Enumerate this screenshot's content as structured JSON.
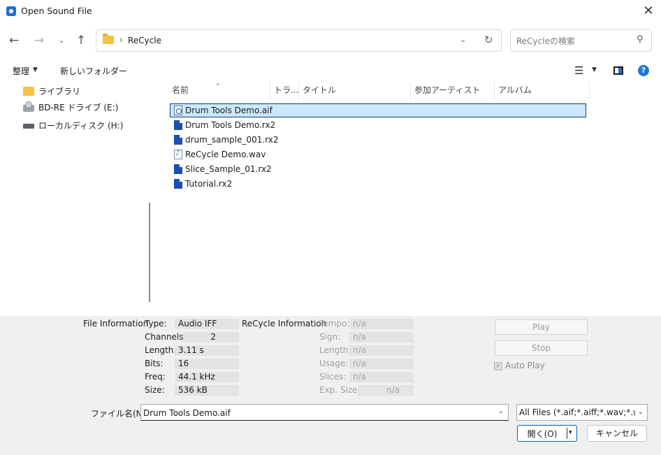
{
  "window": {
    "title": "Open Sound File",
    "close_glyph": "✕"
  },
  "nav": {
    "back_icon": "←",
    "forward_icon": "→",
    "recent_icon": "⌄",
    "up_icon": "↑",
    "breadcrumb_sep": "›",
    "breadcrumb": "ReCycle",
    "address_dropdown_icon": "⌄",
    "refresh_icon": "↻",
    "search_placeholder": "ReCycleの検索",
    "search_icon": "⚲"
  },
  "toolbar": {
    "organize": "整理",
    "organize_caret": "▼",
    "new_folder": "新しいフォルダー",
    "view_icon": "☰",
    "view_caret": "▼",
    "help": "?"
  },
  "navpane": {
    "items": [
      {
        "label": "ライブラリ",
        "icon": "library-icon"
      },
      {
        "label": "BD-RE ドライブ (E:)",
        "icon": "bd-drive-icon"
      },
      {
        "label": "ローカルディスク (H:)",
        "icon": "hard-drive-icon"
      }
    ]
  },
  "filelist": {
    "sort_caret": "⌃",
    "columns": [
      "名前",
      "トラ...",
      "タイトル",
      "参加アーティスト",
      "アルバム"
    ],
    "files": [
      {
        "name": "Drum Tools Demo.aif",
        "type": "aif",
        "selected": true
      },
      {
        "name": "Drum Tools Demo.rx2",
        "type": "rx2",
        "selected": false
      },
      {
        "name": "drum_sample_001.rx2",
        "type": "rx2",
        "selected": false
      },
      {
        "name": "ReCycle Demo.wav",
        "type": "wav",
        "selected": false
      },
      {
        "name": "Slice_Sample_01.rx2",
        "type": "rx2",
        "selected": false
      },
      {
        "name": "Tutorial.rx2",
        "type": "rx2",
        "selected": false
      }
    ]
  },
  "file_info": {
    "heading": "File Information",
    "rows": [
      {
        "label": "Type:",
        "value": "Audio IFF"
      },
      {
        "label": "Channels:",
        "value": "2"
      },
      {
        "label": "Length:",
        "value": "3.11 s"
      },
      {
        "label": "Bits:",
        "value": "16"
      },
      {
        "label": "Freq:",
        "value": "44.1 kHz"
      },
      {
        "label": "Size:",
        "value": "536 kB"
      }
    ]
  },
  "recycle_info": {
    "heading": "ReCycle Information",
    "rows": [
      {
        "label": "Tempo:",
        "value": "n/a"
      },
      {
        "label": "Sign:",
        "value": "n/a"
      },
      {
        "label": "Length:",
        "value": "n/a"
      },
      {
        "label": "Usage:",
        "value": "n/a"
      },
      {
        "label": "Slices:",
        "value": "n/a"
      },
      {
        "label": "Exp. Size:",
        "value": "n/a"
      }
    ]
  },
  "playback": {
    "play": "Play",
    "stop": "Stop",
    "auto_play": "Auto Play",
    "check_glyph": "✓"
  },
  "bottom": {
    "filename_label": "ファイル名(N):",
    "filename_value": "Drum Tools Demo.aif",
    "dropdown_caret": "⌄",
    "filetype": "All Files (*.aif;*.aiff;*.wav;*.wave",
    "open": "開く(O)",
    "open_caret": "▾",
    "cancel": "キャンセル"
  },
  "colors": {
    "accent": "#0067c0",
    "selection": "#cce8ff",
    "panel": "#f0f0f0"
  }
}
